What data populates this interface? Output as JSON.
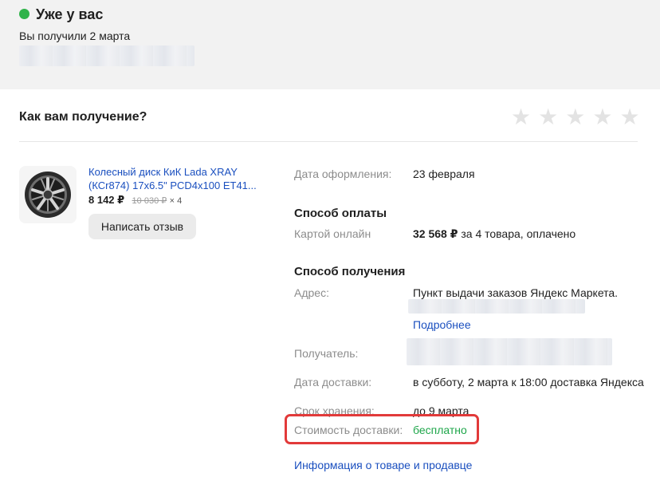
{
  "status": {
    "title": "Уже у вас",
    "received_date": "Вы получили 2 марта",
    "dot_color": "#2fb34a"
  },
  "rating": {
    "question": "Как вам получение?",
    "stars": [
      "★",
      "★",
      "★",
      "★",
      "★"
    ]
  },
  "product": {
    "name": "Колесный диск КиК Lada XRAY (КСr874) 17x6.5\" PCD4x100 ET41...",
    "price": "8 142 ₽",
    "old_price": "10 030 ₽",
    "quantity": "× 4",
    "review_button": "Написать отзыв"
  },
  "order": {
    "created_label": "Дата оформления:",
    "created_value": "23 февраля",
    "payment_title": "Способ оплаты",
    "payment_label": "Картой онлайн",
    "payment_amount": "32 568 ₽",
    "payment_details": " за 4 товара, оплачено",
    "delivery_title": "Способ получения",
    "address_label": "Адрес:",
    "address_value": "Пункт выдачи заказов Яндекс Маркета.",
    "more_link": "Подробнее",
    "recipient_label": "Получатель:",
    "delivery_date_label": "Дата доставки:",
    "delivery_date_value": "в субботу, 2 марта к 18:00 доставка Яндекса",
    "storage_label": "Срок хранения:",
    "storage_value": "до 9 марта",
    "cost_label": "Стоимость доставки:",
    "cost_value": "бесплатно",
    "info_link": "Информация о товаре и продавце"
  },
  "colors": {
    "link": "#1a4fbf",
    "free": "#1ea64a",
    "highlight": "#e23a3a"
  }
}
